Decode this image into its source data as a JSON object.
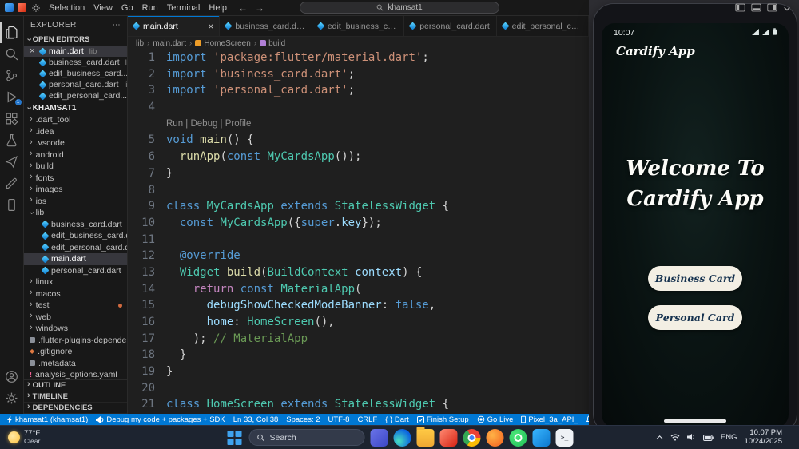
{
  "colors": {
    "accent": "#0078d4",
    "statusbar_blue": "#0078d4",
    "dart_blue": "#13b9fd",
    "phone_button_bg": "#f3efe4",
    "phone_button_text": "#16324f"
  },
  "titlebar": {
    "menus": [
      "Selection",
      "View",
      "Go",
      "Run",
      "Terminal",
      "Help"
    ],
    "back_arrow": "←",
    "forward_arrow": "→",
    "search_value": "khamsat1"
  },
  "sidebar": {
    "title": "EXPLORER",
    "more_label": "⋯",
    "sections": {
      "open_editors": "OPEN EDITORS",
      "project": "KHAMSAT1"
    },
    "open_editors": [
      {
        "name": "main.dart",
        "detail": "lib",
        "active": true
      },
      {
        "name": "business_card.dart",
        "detail": "lib",
        "active": false
      },
      {
        "name": "edit_business_card...",
        "detail": "",
        "active": false
      },
      {
        "name": "personal_card.dart",
        "detail": "lib",
        "active": false
      },
      {
        "name": "edit_personal_card...",
        "detail": "",
        "active": false
      }
    ],
    "tree": [
      {
        "name": ".dart_tool",
        "kind": "folder",
        "indent": 0
      },
      {
        "name": ".idea",
        "kind": "folder",
        "indent": 0
      },
      {
        "name": ".vscode",
        "kind": "folder",
        "indent": 0
      },
      {
        "name": "android",
        "kind": "folder",
        "indent": 0
      },
      {
        "name": "build",
        "kind": "folder",
        "indent": 0
      },
      {
        "name": "fonts",
        "kind": "folder",
        "indent": 0
      },
      {
        "name": "images",
        "kind": "folder",
        "indent": 0
      },
      {
        "name": "ios",
        "kind": "folder",
        "indent": 0
      },
      {
        "name": "lib",
        "kind": "folder",
        "indent": 0,
        "expanded": true
      },
      {
        "name": "business_card.dart",
        "kind": "dart",
        "indent": 1
      },
      {
        "name": "edit_business_card.dart",
        "kind": "dart",
        "indent": 1
      },
      {
        "name": "edit_personal_card.dart",
        "kind": "dart",
        "indent": 1
      },
      {
        "name": "main.dart",
        "kind": "dart",
        "indent": 1,
        "selected": true
      },
      {
        "name": "personal_card.dart",
        "kind": "dart",
        "indent": 1
      },
      {
        "name": "linux",
        "kind": "folder",
        "indent": 0
      },
      {
        "name": "macos",
        "kind": "folder",
        "indent": 0
      },
      {
        "name": "test",
        "kind": "folder",
        "indent": 0,
        "dot": true
      },
      {
        "name": "web",
        "kind": "folder",
        "indent": 0
      },
      {
        "name": "windows",
        "kind": "folder",
        "indent": 0
      },
      {
        "name": ".flutter-plugins-depende...",
        "kind": "file",
        "indent": 0
      },
      {
        "name": ".gitignore",
        "kind": "git",
        "indent": 0
      },
      {
        "name": ".metadata",
        "kind": "file",
        "indent": 0
      },
      {
        "name": "analysis_options.yaml",
        "kind": "warn",
        "indent": 0
      }
    ],
    "bottom_sections": [
      "OUTLINE",
      "TIMELINE",
      "DEPENDENCIES"
    ]
  },
  "tabs": [
    {
      "label": "main.dart",
      "active": true
    },
    {
      "label": "business_card.dart",
      "active": false
    },
    {
      "label": "edit_business_card.dart",
      "active": false
    },
    {
      "label": "personal_card.dart",
      "active": false
    },
    {
      "label": "edit_personal_card.dart",
      "active": false
    }
  ],
  "breadcrumb": [
    {
      "label": "lib",
      "icon": ""
    },
    {
      "label": "main.dart",
      "icon": ""
    },
    {
      "label": "HomeScreen",
      "icon": "class"
    },
    {
      "label": "build",
      "icon": "method"
    }
  ],
  "editor": {
    "lines": [
      {
        "n": "1",
        "t": [
          [
            "kw",
            "import"
          ],
          [
            "d",
            " "
          ],
          [
            "str",
            "'package:flutter/material.dart'"
          ],
          [
            "d",
            ";"
          ]
        ]
      },
      {
        "n": "2",
        "t": [
          [
            "kw",
            "import"
          ],
          [
            "d",
            " "
          ],
          [
            "str",
            "'business_card.dart'"
          ],
          [
            "d",
            ";"
          ]
        ]
      },
      {
        "n": "3",
        "t": [
          [
            "kw",
            "import"
          ],
          [
            "d",
            " "
          ],
          [
            "str",
            "'personal_card.dart'"
          ],
          [
            "d",
            ";"
          ]
        ]
      },
      {
        "n": "4",
        "t": []
      },
      {
        "lens": "Run | Debug | Profile"
      },
      {
        "n": "5",
        "t": [
          [
            "kw",
            "void"
          ],
          [
            "d",
            " "
          ],
          [
            "fn",
            "main"
          ],
          [
            "d",
            "() {"
          ]
        ]
      },
      {
        "n": "6",
        "t": [
          [
            "d",
            "  "
          ],
          [
            "fn",
            "runApp"
          ],
          [
            "d",
            "("
          ],
          [
            "kw",
            "const"
          ],
          [
            "d",
            " "
          ],
          [
            "type",
            "MyCardsApp"
          ],
          [
            "d",
            "());"
          ]
        ]
      },
      {
        "n": "7",
        "t": [
          [
            "d",
            "}"
          ]
        ]
      },
      {
        "n": "8",
        "t": []
      },
      {
        "n": "9",
        "t": [
          [
            "kw",
            "class"
          ],
          [
            "d",
            " "
          ],
          [
            "type",
            "MyCardsApp"
          ],
          [
            "d",
            " "
          ],
          [
            "kw",
            "extends"
          ],
          [
            "d",
            " "
          ],
          [
            "type",
            "StatelessWidget"
          ],
          [
            "d",
            " {"
          ]
        ]
      },
      {
        "n": "10",
        "t": [
          [
            "d",
            "  "
          ],
          [
            "kw",
            "const"
          ],
          [
            "d",
            " "
          ],
          [
            "type",
            "MyCardsApp"
          ],
          [
            "d",
            "({"
          ],
          [
            "kw",
            "super"
          ],
          [
            "d",
            "."
          ],
          [
            "prop",
            "key"
          ],
          [
            "d",
            "});"
          ]
        ]
      },
      {
        "n": "11",
        "t": []
      },
      {
        "n": "12",
        "t": [
          [
            "d",
            "  "
          ],
          [
            "kw",
            "@override"
          ]
        ]
      },
      {
        "n": "13",
        "t": [
          [
            "d",
            "  "
          ],
          [
            "type",
            "Widget"
          ],
          [
            "d",
            " "
          ],
          [
            "fn",
            "build"
          ],
          [
            "d",
            "("
          ],
          [
            "type",
            "BuildContext"
          ],
          [
            "d",
            " "
          ],
          [
            "prop",
            "context"
          ],
          [
            "d",
            ") {"
          ]
        ]
      },
      {
        "n": "14",
        "t": [
          [
            "d",
            "    "
          ],
          [
            "ctrl",
            "return"
          ],
          [
            "d",
            " "
          ],
          [
            "kw",
            "const"
          ],
          [
            "d",
            " "
          ],
          [
            "type",
            "MaterialApp"
          ],
          [
            "d",
            "("
          ]
        ]
      },
      {
        "n": "15",
        "t": [
          [
            "d",
            "      "
          ],
          [
            "prop",
            "debugShowCheckedModeBanner"
          ],
          [
            "d",
            ": "
          ],
          [
            "kw",
            "false"
          ],
          [
            "d",
            ","
          ]
        ]
      },
      {
        "n": "16",
        "t": [
          [
            "d",
            "      "
          ],
          [
            "prop",
            "home"
          ],
          [
            "d",
            ": "
          ],
          [
            "type",
            "HomeScreen"
          ],
          [
            "d",
            "(),"
          ]
        ]
      },
      {
        "n": "17",
        "t": [
          [
            "d",
            "    ); "
          ],
          [
            "com",
            "// MaterialApp"
          ]
        ]
      },
      {
        "n": "18",
        "t": [
          [
            "d",
            "  }"
          ]
        ]
      },
      {
        "n": "19",
        "t": [
          [
            "d",
            "}"
          ]
        ]
      },
      {
        "n": "20",
        "t": []
      },
      {
        "n": "21",
        "t": [
          [
            "kw",
            "class"
          ],
          [
            "d",
            " "
          ],
          [
            "type",
            "HomeScreen"
          ],
          [
            "d",
            " "
          ],
          [
            "kw",
            "extends"
          ],
          [
            "d",
            " "
          ],
          [
            "type",
            "StatelessWidget"
          ],
          [
            "d",
            " {"
          ]
        ]
      }
    ]
  },
  "status_bar": {
    "left": [
      {
        "icon": "flash",
        "label": "khamsat1 (khamsat1)"
      },
      {
        "icon": "mega",
        "label": "Debug my code + packages + SDK"
      }
    ],
    "right": [
      {
        "icon": "",
        "label": "Ln 33, Col 38"
      },
      {
        "icon": "",
        "label": "Spaces: 2"
      },
      {
        "icon": "",
        "label": "UTF-8"
      },
      {
        "icon": "",
        "label": "CRLF"
      },
      {
        "icon": "",
        "label": "{ } Dart"
      },
      {
        "icon": "check",
        "label": "Finish Setup"
      },
      {
        "icon": "live",
        "label": "Go Live"
      },
      {
        "icon": "device",
        "label": "Pixel_3a_API_"
      },
      {
        "icon": "bell",
        "label": ""
      }
    ]
  },
  "phone": {
    "status_time": "10:07",
    "app_title": "Cardify App",
    "welcome": [
      "Welcome To",
      "Cardify App"
    ],
    "buttons": [
      "Business Card",
      "Personal Card"
    ]
  },
  "taskbar": {
    "weather": {
      "temp": "77°F",
      "desc": "Clear"
    },
    "search_label": "Search",
    "apps": [
      {
        "name": "widgets-icon",
        "style": "indigo"
      },
      {
        "name": "edge-icon",
        "style": "edge"
      },
      {
        "name": "file-explorer-icon",
        "style": "folder"
      },
      {
        "name": "app-red-icon",
        "style": "red"
      },
      {
        "name": "chrome-icon",
        "style": "chrome"
      },
      {
        "name": "app-orange-icon",
        "style": "orange"
      },
      {
        "name": "whatsapp-icon",
        "style": "green"
      },
      {
        "name": "vscode-icon",
        "style": "vscode"
      },
      {
        "name": "terminal-icon",
        "style": "light"
      }
    ],
    "tray": {
      "lang": "ENG",
      "time": "10:07 PM",
      "date": "10/24/2025"
    }
  }
}
